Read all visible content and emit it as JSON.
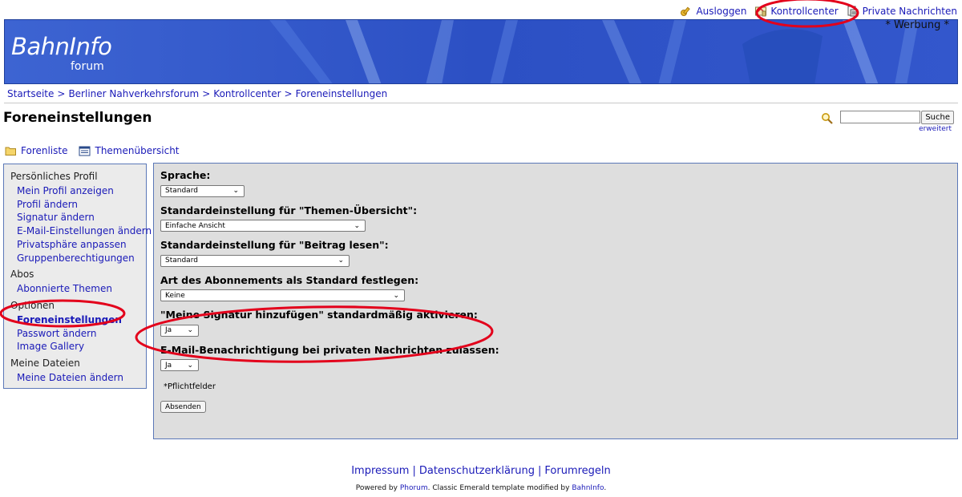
{
  "header": {
    "links": [
      {
        "label": "Ausloggen",
        "icon": "key-icon"
      },
      {
        "label": "Kontrollcenter",
        "icon": "control-center-icon"
      },
      {
        "label": "Private Nachrichten",
        "icon": "private-messages-icon"
      }
    ],
    "werbung": "* Werbung *"
  },
  "banner": {
    "logo_text": "BahnInfo",
    "logo_sub": "forum",
    "colors": {
      "primary": "#2f55c9",
      "light": "#6d94e6"
    }
  },
  "breadcrumb": [
    "Startseite",
    "Berliner Nahverkehrsforum",
    "Kontrollcenter",
    "Foreneinstellungen"
  ],
  "breadcrumb_sep": ">",
  "page_title": "Foreneinstellungen",
  "search": {
    "button_label": "Suche",
    "advanced_label": "erweitert",
    "value": ""
  },
  "nav": {
    "forenliste": "Forenliste",
    "themen": "Themenübersicht"
  },
  "sidebar": {
    "groups": [
      {
        "heading": "Persönliches Profil",
        "items": [
          "Mein Profil anzeigen",
          "Profil ändern",
          "Signatur ändern",
          "E-Mail-Einstellungen ändern",
          "Privatsphäre anpassen",
          "Gruppenberechtigungen"
        ]
      },
      {
        "heading": "Abos",
        "items": [
          "Abonnierte Themen"
        ]
      },
      {
        "heading": "Optionen",
        "items": [
          "Foreneinstellungen",
          "Passwort ändern",
          "Image Gallery"
        ]
      },
      {
        "heading": "Meine Dateien",
        "items": [
          "Meine Dateien ändern"
        ]
      }
    ],
    "active_item": "Foreneinstellungen"
  },
  "form": {
    "fields": [
      {
        "label": "Sprache:",
        "value": "Standard"
      },
      {
        "label": "Standardeinstellung für \"Themen-Übersicht\":",
        "value": "Einfache Ansicht"
      },
      {
        "label": "Standardeinstellung für \"Beitrag lesen\":",
        "value": "Standard"
      },
      {
        "label": "Art des Abonnements als Standard festlegen:",
        "value": "Keine"
      },
      {
        "label": "\"Meine Signatur hinzufügen\" standardmäßig aktivieren:",
        "value": "Ja"
      },
      {
        "label": "E-Mail-Benachrichtigung bei privaten Nachrichten zulassen:",
        "value": "Ja"
      }
    ],
    "required_note": "*Pflichtfelder",
    "submit_label": "Absenden"
  },
  "footer": {
    "links": [
      "Impressum",
      "Datenschutzerklärung",
      "Forumregeln"
    ],
    "separator": "|",
    "powered_prefix": "Powered by",
    "powered_phorum": "Phorum",
    "powered_middle": ". Classic Emerald template modified by",
    "powered_bahninfo": "BahnInfo",
    "powered_end": "."
  },
  "annotation_color": "#e3001b"
}
